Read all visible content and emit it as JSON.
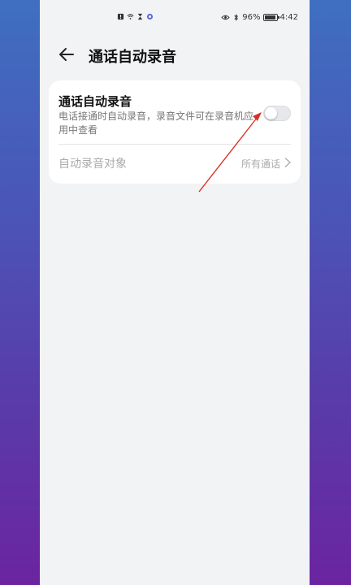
{
  "status_bar": {
    "left_icons": [
      "alert-icon",
      "wifi-icon",
      "hourglass-icon",
      "app-notification-icon"
    ],
    "battery_percent": "96%",
    "time": "4:42"
  },
  "header": {
    "title": "通话自动录音"
  },
  "settings": {
    "auto_record": {
      "title": "通话自动录音",
      "description": "电话接通时自动录音，录音文件可在录音机应用中查看",
      "enabled": false
    },
    "record_target": {
      "label": "自动录音对象",
      "value": "所有通话"
    }
  },
  "annotation": {
    "color": "#d93025"
  }
}
